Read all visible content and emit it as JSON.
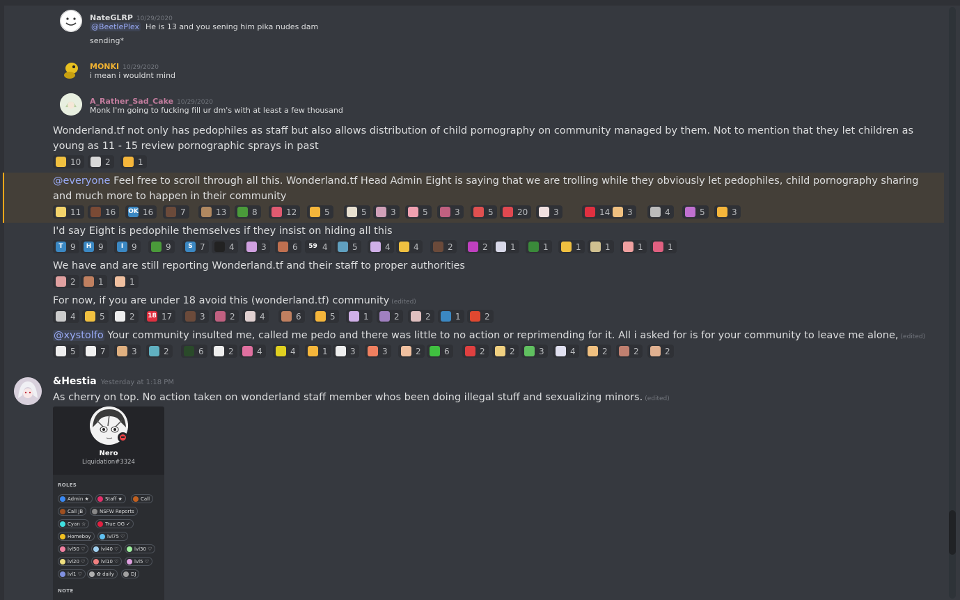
{
  "replies": [
    {
      "username": "NateGLRP",
      "name_color": "#dcddde",
      "timestamp": "10/29/2020",
      "mention": "@BeetlePlex",
      "text": "He is 13 and you sening him pika nudes dam",
      "text2": "sending*"
    },
    {
      "username": "MONKI",
      "name_color": "#f0b232",
      "timestamp": "10/29/2020",
      "text": "i mean i wouldnt mind"
    },
    {
      "username": "A_Rather_Sad_Cake",
      "name_color": "#c27c9d",
      "timestamp": "10/29/2020",
      "text": "Monk I'm going to fucking fill ur dm's with at least a few thousand"
    }
  ],
  "messages": [
    {
      "text": "Wonderland.tf not only has pedophiles as staff but also allows distribution of child pornography on community managed by them. Not to mention that they let children as young as 11 - 15 review pornographic sprays in past",
      "reactions": [
        {
          "icon": "emoji-sleepy",
          "color": "#f0c040",
          "count": "10"
        },
        {
          "icon": "emoji-cat",
          "color": "#d8d8d8",
          "count": "2"
        },
        {
          "icon": "emoji-hug",
          "color": "#f5b63b",
          "count": "1"
        }
      ]
    },
    {
      "mention": "@everyone",
      "text": "Feel free to scroll through all this. Wonderland.tf Head Admin Eight is saying that we are trolling while they obviously let pedophiles, child pornography sharing and much more to happen in their community",
      "reactions": [
        {
          "icon": "emoji-a",
          "color": "#f3d36b",
          "count": "11"
        },
        {
          "icon": "emoji-b",
          "color": "#7a4a35",
          "count": "16"
        },
        {
          "icon": "emoji-ok",
          "color": "#3b88c3",
          "label": "OK",
          "count": "16"
        },
        {
          "icon": "emoji-c",
          "color": "#6b4a3a",
          "count": "7"
        },
        {
          "icon": "emoji-d",
          "color": "#b08860",
          "count": "13"
        },
        {
          "icon": "emoji-pepe",
          "color": "#4a9a3a",
          "count": "8"
        },
        {
          "icon": "emoji-e",
          "color": "#e05a70",
          "count": "12"
        },
        {
          "icon": "emoji-upside",
          "color": "#f5b63b",
          "count": "5"
        },
        {
          "icon": "emoji-f",
          "color": "#e8e0d0",
          "count": "5"
        },
        {
          "icon": "emoji-g",
          "color": "#d0a0b8",
          "count": "3"
        },
        {
          "icon": "emoji-h",
          "color": "#f0a0b0",
          "count": "5"
        },
        {
          "icon": "emoji-i",
          "color": "#c06080",
          "count": "3"
        },
        {
          "icon": "emoji-rainbow",
          "color": "#e05050",
          "count": "5"
        },
        {
          "icon": "emoji-j",
          "color": "#e04850",
          "count": "20"
        },
        {
          "icon": "emoji-k",
          "color": "#f0e0e0",
          "count": "3"
        },
        {
          "icon": "emoji-l",
          "color": "#e03040",
          "count": "14"
        },
        {
          "icon": "emoji-m",
          "color": "#f0c080",
          "count": "3"
        },
        {
          "icon": "emoji-truth",
          "color": "#bbbbbb",
          "count": "4"
        },
        {
          "icon": "emoji-nani",
          "color": "#c070d0",
          "count": "5"
        },
        {
          "icon": "emoji-thumbsdown",
          "color": "#f5b63b",
          "count": "3"
        }
      ]
    },
    {
      "text": "I'd say Eight is pedophile themselves if they insist on hiding all this",
      "reactions": [
        {
          "icon": "emoji-t",
          "color": "#3b88c3",
          "label": "T",
          "count": "9"
        },
        {
          "icon": "emoji-h",
          "color": "#3b88c3",
          "label": "H",
          "count": "9"
        },
        {
          "icon": "emoji-i",
          "color": "#3b88c3",
          "label": "I",
          "count": "9"
        },
        {
          "icon": "emoji-frog",
          "color": "#4a9a3a",
          "count": "9"
        },
        {
          "icon": "emoji-s",
          "color": "#3b88c3",
          "label": "S",
          "count": "7"
        },
        {
          "icon": "emoji-8ball",
          "color": "#222222",
          "count": "4"
        },
        {
          "icon": "emoji-n",
          "color": "#d0a0e0",
          "count": "3"
        },
        {
          "icon": "emoji-o",
          "color": "#c07050",
          "count": "6"
        },
        {
          "icon": "emoji-59",
          "color": "#36393f",
          "label": "59",
          "count": "4"
        },
        {
          "icon": "emoji-p",
          "color": "#60a0c0",
          "count": "5"
        },
        {
          "icon": "emoji-q",
          "color": "#d0b0e8",
          "count": "4"
        },
        {
          "icon": "emoji-r",
          "color": "#f0c040",
          "count": "4"
        },
        {
          "icon": "emoji-u",
          "color": "#6b4a3a",
          "count": "2"
        },
        {
          "icon": "emoji-v",
          "color": "#c040c0",
          "count": "2"
        },
        {
          "icon": "emoji-w",
          "color": "#d8d8e8",
          "count": "1"
        },
        {
          "icon": "emoji-x",
          "color": "#3a8a3a",
          "count": "1"
        },
        {
          "icon": "emoji-y",
          "color": "#f0c040",
          "count": "1"
        },
        {
          "icon": "emoji-z",
          "color": "#d0c090",
          "count": "1"
        },
        {
          "icon": "emoji-aa",
          "color": "#f0a0a0",
          "count": "1"
        },
        {
          "icon": "emoji-lungs",
          "color": "#e06080",
          "count": "1"
        }
      ]
    },
    {
      "text": "We have and are still reporting Wonderland.tf and their staff to proper authorities",
      "reactions": [
        {
          "icon": "emoji-ab",
          "color": "#e0a0a0",
          "count": "2"
        },
        {
          "icon": "emoji-ac",
          "color": "#c08060",
          "count": "1"
        },
        {
          "icon": "emoji-ad",
          "color": "#f0c0a0",
          "count": "1"
        }
      ]
    },
    {
      "text": "For now, if you are under 18 avoid this (wonderland.tf) community",
      "edited": "(edited)",
      "reactions": [
        {
          "icon": "emoji-ae",
          "color": "#cccccc",
          "count": "4"
        },
        {
          "icon": "emoji-af",
          "color": "#f0c040",
          "count": "5"
        },
        {
          "icon": "emoji-ag",
          "color": "#eeeeee",
          "count": "2"
        },
        {
          "icon": "emoji-18",
          "color": "#e03040",
          "label": "18",
          "count": "17"
        },
        {
          "icon": "emoji-ah",
          "color": "#6b4a3a",
          "count": "3"
        },
        {
          "icon": "emoji-ai",
          "color": "#c06080",
          "count": "2"
        },
        {
          "icon": "emoji-aj",
          "color": "#e0d0d0",
          "count": "4"
        },
        {
          "icon": "emoji-ak",
          "color": "#c08060",
          "count": "6"
        },
        {
          "icon": "emoji-thumbsup",
          "color": "#f5b63b",
          "count": "5"
        },
        {
          "icon": "emoji-al",
          "color": "#d0b0e8",
          "count": "1"
        },
        {
          "icon": "emoji-am",
          "color": "#a080c0",
          "count": "2"
        },
        {
          "icon": "emoji-an",
          "color": "#e0c0c0",
          "count": "2"
        },
        {
          "icon": "emoji-no-u",
          "color": "#3b88c3",
          "count": "1"
        },
        {
          "icon": "emoji-ao",
          "color": "#e04830",
          "count": "2"
        }
      ]
    },
    {
      "mention": "@xystolfo",
      "text": "Your community insulted me, called me pedo and there was little to no action or reprimending for it. All i asked for is for your community to leave me alone,",
      "edited": "(edited)",
      "reactions": [
        {
          "icon": "emoji-ap",
          "color": "#eeeeee",
          "count": "5"
        },
        {
          "icon": "emoji-aq",
          "color": "#f0f0f0",
          "count": "7"
        },
        {
          "icon": "emoji-ar",
          "color": "#e0b080",
          "count": "3"
        },
        {
          "icon": "emoji-as",
          "color": "#60b0c0",
          "count": "2"
        },
        {
          "icon": "emoji-at",
          "color": "#2a4a2a",
          "count": "6"
        },
        {
          "icon": "emoji-au",
          "color": "#eeeeee",
          "count": "2"
        },
        {
          "icon": "emoji-uwu",
          "color": "#e070a0",
          "count": "4"
        },
        {
          "icon": "emoji-100",
          "color": "#e0d020",
          "count": "4"
        },
        {
          "icon": "emoji-av",
          "color": "#f5b63b",
          "count": "1"
        },
        {
          "icon": "emoji-aw",
          "color": "#eeeeee",
          "count": "3"
        },
        {
          "icon": "emoji-peach",
          "color": "#f08060",
          "count": "3"
        },
        {
          "icon": "emoji-ax",
          "color": "#f0c0a0",
          "count": "2"
        },
        {
          "icon": "emoji-plus1",
          "color": "#40c040",
          "count": "6"
        },
        {
          "icon": "emoji-minus1",
          "color": "#e04040",
          "count": "2"
        },
        {
          "icon": "emoji-ay",
          "color": "#f0d080",
          "count": "2"
        },
        {
          "icon": "emoji-az",
          "color": "#60c060",
          "count": "3"
        },
        {
          "icon": "emoji-ba",
          "color": "#e0e0f0",
          "count": "4"
        },
        {
          "icon": "emoji-bb",
          "color": "#f0c080",
          "count": "2"
        },
        {
          "icon": "emoji-bc",
          "color": "#c08070",
          "count": "2"
        },
        {
          "icon": "emoji-bd",
          "color": "#e0b090",
          "count": "2"
        }
      ]
    }
  ],
  "hestia": {
    "username": "&Hestia",
    "timestamp": "Yesterday at 1:18 PM",
    "text": "As cherry on top. No action taken on wonderland staff member whos been doing illegal stuff and sexualizing minors.",
    "edited": "(edited)",
    "card": {
      "name": "Nero",
      "tag": "Liquidation#3324",
      "roles_title": "ROLES",
      "note_title": "NOTE",
      "roles": [
        {
          "label": "Admin ★",
          "color": "#3b88f0"
        },
        {
          "label": "Staff ★",
          "color": "#e0306a"
        },
        {
          "label": "Call",
          "color": "#c06020"
        },
        {
          "label": "Call JB",
          "color": "#a05020"
        },
        {
          "label": "NSFW Reports",
          "color": "#888888"
        },
        {
          "label": "Cyan ☆",
          "color": "#40e0e0"
        },
        {
          "label": "True OG ✓",
          "color": "#e02040"
        },
        {
          "label": "Homeboy",
          "color": "#f0c020"
        },
        {
          "label": "lvl75 ♡",
          "color": "#60c0f0"
        },
        {
          "label": "lvl50 ♡",
          "color": "#f080a0"
        },
        {
          "label": "lvl40 ♡",
          "color": "#a0d0f0"
        },
        {
          "label": "lvl30 ♡",
          "color": "#a0f0a0"
        },
        {
          "label": "lvl20 ♡",
          "color": "#f0e080"
        },
        {
          "label": "lvl10 ♡",
          "color": "#f08080"
        },
        {
          "label": "lvl5 ♡",
          "color": "#e0a0e0"
        },
        {
          "label": "lvl1 ♡",
          "color": "#8090e0"
        },
        {
          "label": "✿ daily",
          "color": "#b0b0b0"
        },
        {
          "label": "DJ",
          "color": "#a0a0a0"
        }
      ]
    }
  }
}
